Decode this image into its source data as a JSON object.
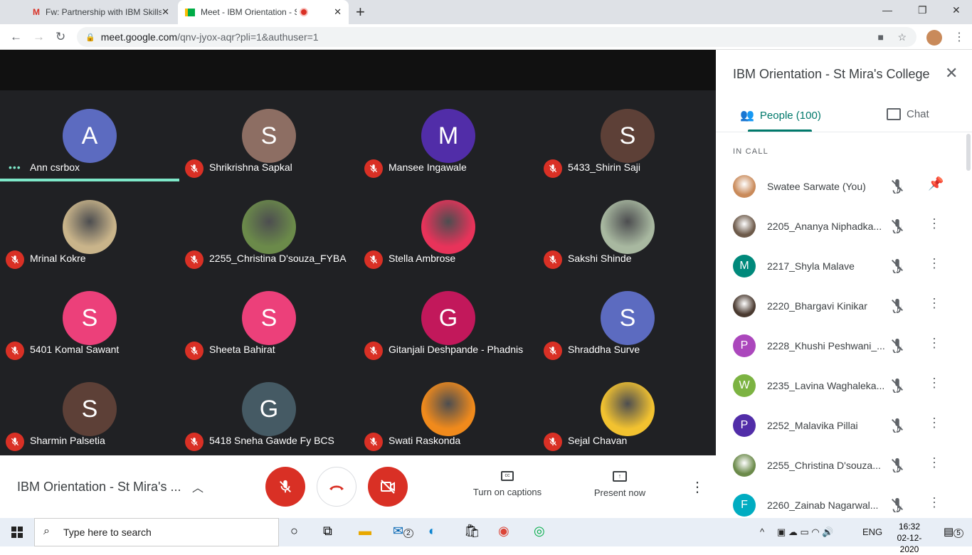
{
  "browser": {
    "tabs": [
      {
        "title": "Fw: Partnership with IBM SkillsBu",
        "icon": "gmail-icon"
      },
      {
        "title": "Meet - IBM Orientation - St M",
        "icon": "meet-icon",
        "recording": true
      }
    ],
    "url_host": "meet.google.com",
    "url_path": "/qnv-jyox-aqr?pli=1&authuser=1"
  },
  "tiles": [
    {
      "name": "Ann csrbox",
      "letter": "A",
      "color": "#5c6bc0",
      "speaking": true
    },
    {
      "name": "Shrikrishna Sapkal",
      "letter": "S",
      "color": "#8d6e63"
    },
    {
      "name": "Mansee Ingawale",
      "letter": "M",
      "color": "#512da8"
    },
    {
      "name": "5433_Shirin Saji",
      "letter": "S",
      "color": "#5d4037"
    },
    {
      "name": "Mrinal Kokre",
      "photo": "#c9b48a"
    },
    {
      "name": "2255_Christina D'souza_FYBA",
      "photo": "#6b8a4a"
    },
    {
      "name": "Stella Ambrose",
      "photo": "#e8335a"
    },
    {
      "name": "Sakshi Shinde",
      "photo": "#a8b8a0"
    },
    {
      "name": "5401 Komal Sawant",
      "letter": "S",
      "color": "#ec407a"
    },
    {
      "name": "Sheeta Bahirat",
      "letter": "S",
      "color": "#ec407a"
    },
    {
      "name": "Gitanjali Deshpande - Phadnis",
      "letter": "G",
      "color": "#c2185b"
    },
    {
      "name": "Shraddha Surve",
      "letter": "S",
      "color": "#5c6bc0"
    },
    {
      "name": "Sharmin Palsetia",
      "letter": "S",
      "color": "#5d4037"
    },
    {
      "name": "5418 Sneha Gawde Fy BCS",
      "letter": "G",
      "color": "#455a64"
    },
    {
      "name": "Swati Raskonda",
      "photo": "#f08a1c"
    },
    {
      "name": "Sejal Chavan",
      "photo": "#f2c230"
    }
  ],
  "bottom": {
    "meeting_title": "IBM Orientation - St Mira's ...",
    "captions": "Turn on captions",
    "present": "Present now"
  },
  "panel": {
    "title": "IBM Orientation - St Mira's College",
    "people_tab": "People (100)",
    "chat_tab": "Chat",
    "section": "IN CALL",
    "people": [
      {
        "name": "Swatee Sarwate (You)",
        "photo": "#c98a5a",
        "pin": true
      },
      {
        "name": "2205_Ananya Niphadka...",
        "photo": "#6d5a4a"
      },
      {
        "name": "2217_Shyla Malave",
        "letter": "M",
        "color": "#00897b"
      },
      {
        "name": "2220_Bhargavi Kinikar",
        "photo": "#4a3a30"
      },
      {
        "name": "2228_Khushi Peshwani_...",
        "letter": "P",
        "color": "#ab47bc"
      },
      {
        "name": "2235_Lavina Waghaleka...",
        "letter": "W",
        "color": "#7cb342"
      },
      {
        "name": "2252_Malavika Pillai",
        "letter": "P",
        "color": "#512da8"
      },
      {
        "name": "2255_Christina D'souza...",
        "photo": "#6b8a4a"
      },
      {
        "name": "2260_Zainab Nagarwal...",
        "letter": "F",
        "color": "#00acc1"
      }
    ]
  },
  "taskbar": {
    "search_placeholder": "Type here to search",
    "lang": "ENG",
    "time": "16:32",
    "date": "02-12-2020",
    "mail_badge": "2",
    "notif_count": "5"
  },
  "colors": {
    "accent": "#00796b",
    "end_call": "#d93025",
    "stage": "#202124"
  }
}
